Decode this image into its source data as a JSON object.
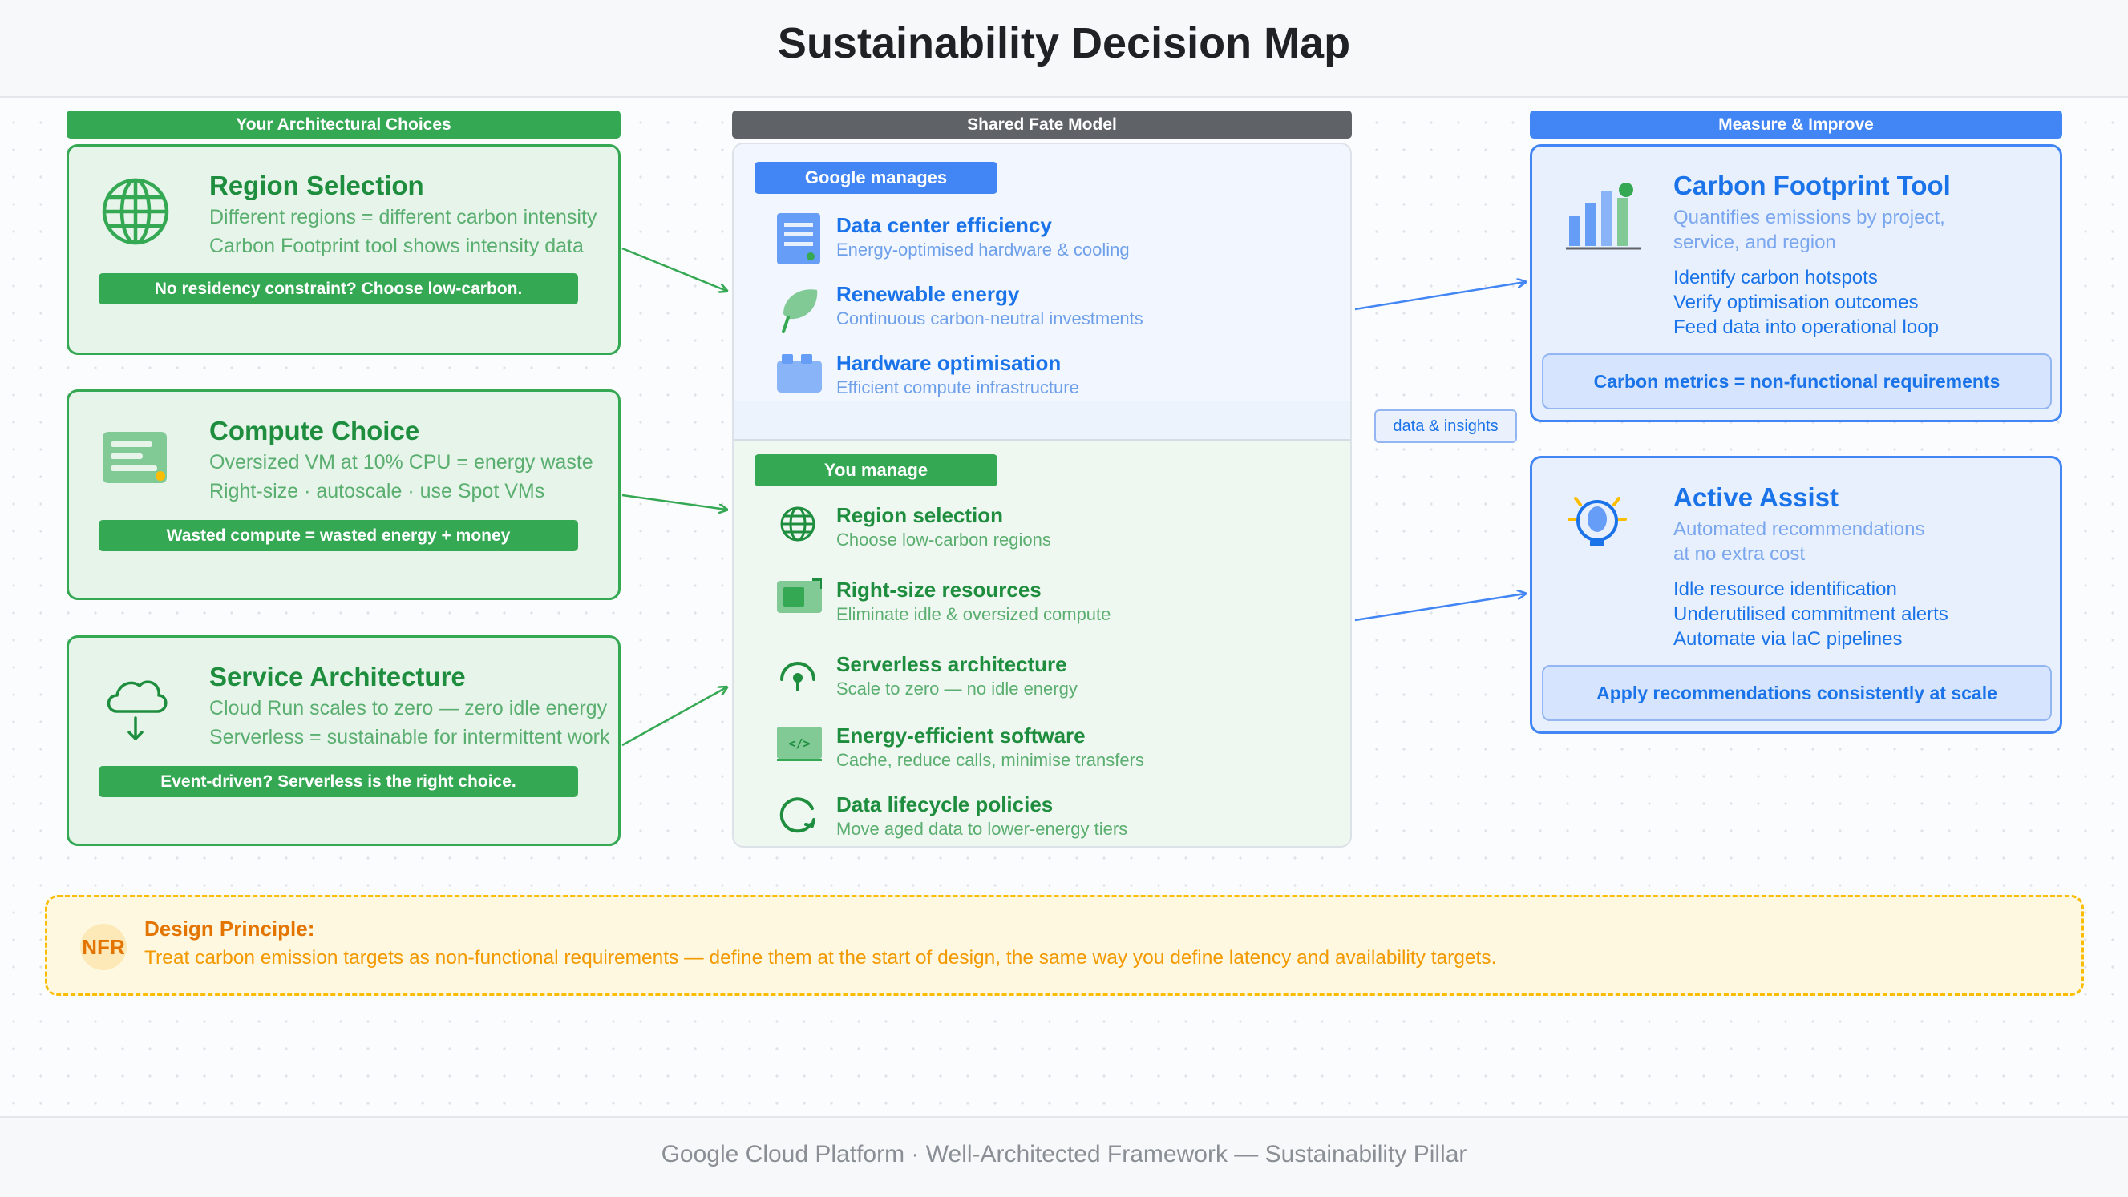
{
  "title": "Sustainability Decision Map",
  "footer": "Google Cloud Platform · Well-Architected Framework — Sustainability Pillar",
  "colors": {
    "green": "#34a853",
    "blue": "#4285f4",
    "gray": "#5f6368",
    "amber": "#fbbc04"
  },
  "left": {
    "header": "Your Architectural Choices",
    "cards": [
      {
        "title": "Region Selection",
        "lines": [
          "Different regions = different carbon intensity",
          "Carbon Footprint tool shows intensity data"
        ],
        "pill": "No residency constraint? Choose low-carbon.",
        "icon": "globe-icon"
      },
      {
        "title": "Compute Choice",
        "lines": [
          "Oversized VM at 10% CPU = energy waste",
          "Right-size · autoscale · use Spot VMs"
        ],
        "pill": "Wasted compute = wasted energy + money",
        "icon": "server-icon"
      },
      {
        "title": "Service Architecture",
        "lines": [
          "Cloud Run scales to zero — zero idle energy",
          "Serverless = sustainable for intermittent work"
        ],
        "pill": "Event-driven? Serverless is the right choice.",
        "icon": "cloud-download-icon"
      }
    ]
  },
  "middle": {
    "header": "Shared Fate Model",
    "google_tag": "Google manages",
    "google_items": [
      {
        "title": "Data center efficiency",
        "sub": "Energy-optimised hardware & cooling",
        "icon": "datacenter-icon"
      },
      {
        "title": "Renewable energy",
        "sub": "Continuous carbon-neutral investments",
        "icon": "leaf-icon"
      },
      {
        "title": "Hardware optimisation",
        "sub": "Efficient compute infrastructure",
        "icon": "hardware-icon"
      }
    ],
    "you_tag": "You manage",
    "you_items": [
      {
        "title": "Region selection",
        "sub": "Choose low-carbon regions",
        "icon": "globe-icon"
      },
      {
        "title": "Right-size resources",
        "sub": "Eliminate idle & oversized compute",
        "icon": "resize-icon"
      },
      {
        "title": "Serverless architecture",
        "sub": "Scale to zero — no idle energy",
        "icon": "serverless-icon"
      },
      {
        "title": "Energy-efficient software",
        "sub": "Cache, reduce calls, minimise transfers",
        "icon": "code-icon"
      },
      {
        "title": "Data lifecycle policies",
        "sub": "Move aged data to lower-energy tiers",
        "icon": "lifecycle-icon"
      }
    ]
  },
  "data_tag": "data & insights",
  "right": {
    "header": "Measure & Improve",
    "cards": [
      {
        "title": "Carbon Footprint Tool",
        "desc": [
          "Quantifies emissions by project,",
          "service, and region"
        ],
        "bullets": [
          "Identify carbon hotspots",
          "Verify optimisation outcomes",
          "Feed data into operational loop"
        ],
        "note": "Carbon metrics = non-functional requirements",
        "icon": "bar-chart-icon"
      },
      {
        "title": "Active Assist",
        "desc": [
          "Automated recommendations",
          "at no extra cost"
        ],
        "bullets": [
          "Idle resource identification",
          "Underutilised commitment alerts",
          "Automate via IaC pipelines"
        ],
        "note": "Apply recommendations consistently at scale",
        "icon": "lightbulb-icon"
      }
    ]
  },
  "principle": {
    "badge": "NFR",
    "label": "Design Principle:",
    "text": "Treat carbon emission targets as non-functional requirements — define them at the start of design, the same way you define latency and availability targets."
  }
}
